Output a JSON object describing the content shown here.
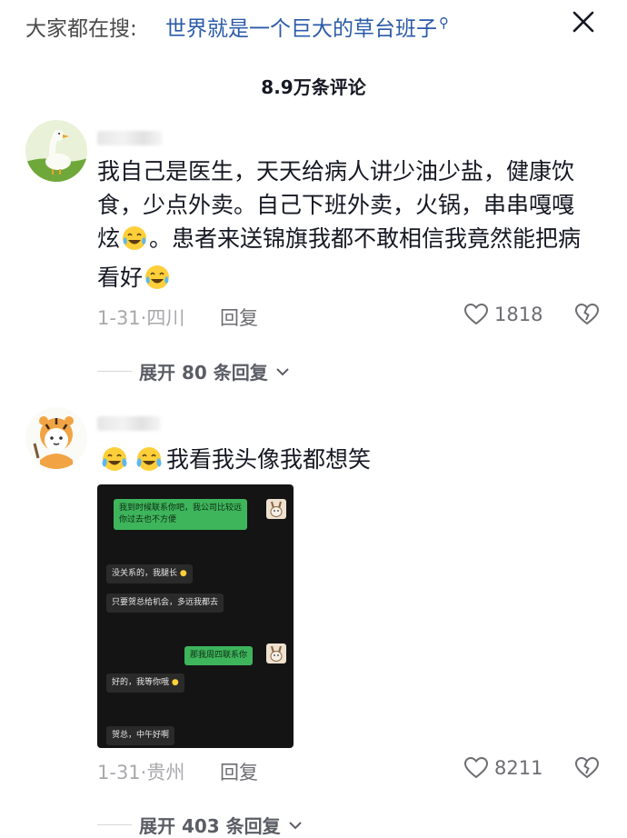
{
  "header": {
    "search_prefix": "大家都在搜:",
    "search_query": "世界就是一个巨大的草台班子",
    "comment_count": "8.9万条评论"
  },
  "comments": [
    {
      "text_before_emoji1": "我自己是医生，天天给病人讲少油少盐，健康饮食，少点外卖。自己下班外卖，火锅，串串嘎嘎炫",
      "text_between": "。患者来送锦旗我都不敢相信我竟然能把病看好",
      "date": "1-31·四川",
      "reply_label": "回复",
      "likes": "1818",
      "expand_label": "展开 80 条回复"
    },
    {
      "text": "我看我头像我都想笑",
      "date": "1-31·贵州",
      "reply_label": "回复",
      "likes": "8211",
      "expand_label": "展开 403 条回复"
    }
  ],
  "chat": {
    "messages": [
      {
        "side": "sent",
        "text": "我到时候联系你吧，我公司比较远"
      },
      {
        "side": "sent",
        "text": "你过去也不方便"
      },
      {
        "side": "recv",
        "text": "没关系的，我腿长"
      },
      {
        "side": "recv",
        "text": "只要贺总给机会，多远我都去"
      },
      {
        "side": "sent",
        "text": "那我周四联系你"
      },
      {
        "side": "recv",
        "text": "好的，我等你哦"
      },
      {
        "side": "recv",
        "text": "贺总，中午好啊"
      }
    ]
  },
  "colors": {
    "accent_link": "#2a5aa8",
    "meta_gray": "#a9a9ad",
    "chat_sent": "#3eb55b"
  }
}
